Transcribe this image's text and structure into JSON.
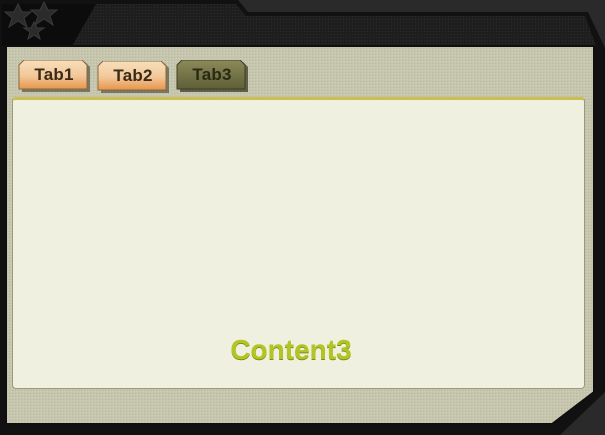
{
  "tabs": [
    {
      "label": "Tab1",
      "active": false
    },
    {
      "label": "Tab2",
      "active": false
    },
    {
      "label": "Tab3",
      "active": true
    }
  ],
  "content": {
    "text": "Content3"
  },
  "colors": {
    "frame_dark": "#1b1b1b",
    "panel_bg": "#c8c8b0",
    "content_bg": "#eff0df",
    "tab_inactive_top": "#f6dbb2",
    "tab_inactive_bottom": "#e89a4a",
    "tab_active": "#6d6d43",
    "content_text": "#b3c524",
    "accent_line": "#c9bf52"
  }
}
